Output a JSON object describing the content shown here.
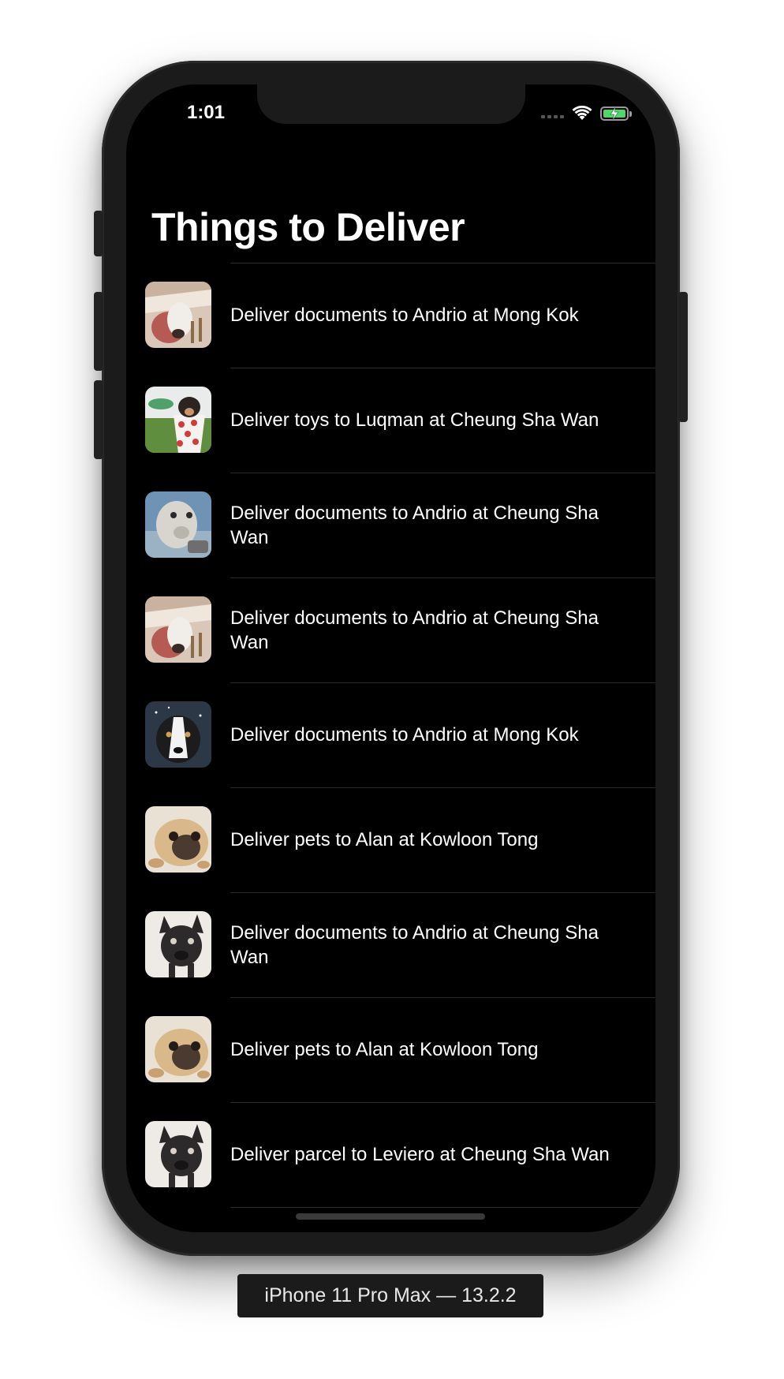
{
  "status_bar": {
    "time": "1:01",
    "icons": [
      "cellular-signal-icon",
      "wifi-icon",
      "battery-charging-icon"
    ],
    "battery_color": "#4cd964"
  },
  "nav": {
    "title": "Things to Deliver"
  },
  "deliveries": [
    {
      "text": "Deliver documents to Andrio at Mong Kok",
      "image": "white-pony-photo"
    },
    {
      "text": "Deliver toys to Luqman at Cheung Sha Wan",
      "image": "puppy-in-polka-dot-cup-photo"
    },
    {
      "text": "Deliver documents to Andrio at Cheung Sha Wan",
      "image": "alpaca-photo"
    },
    {
      "text": "Deliver documents to Andrio at Cheung Sha Wan",
      "image": "white-pony-photo"
    },
    {
      "text": "Deliver documents to Andrio at Mong Kok",
      "image": "border-collie-photo"
    },
    {
      "text": "Deliver pets to Alan at Kowloon Tong",
      "image": "pug-photo"
    },
    {
      "text": "Deliver documents to Andrio at Cheung Sha Wan",
      "image": "french-bulldog-photo"
    },
    {
      "text": "Deliver pets to Alan at Kowloon Tong",
      "image": "pug-photo"
    },
    {
      "text": "Deliver parcel to Leviero at Cheung Sha Wan",
      "image": "french-bulldog-photo"
    }
  ],
  "simulator": {
    "label": "iPhone 11 Pro Max — 13.2.2"
  },
  "colors": {
    "background": "#000000",
    "text": "#ffffff",
    "separator": "#2a2a2a",
    "frame": "#1b1b1b"
  }
}
